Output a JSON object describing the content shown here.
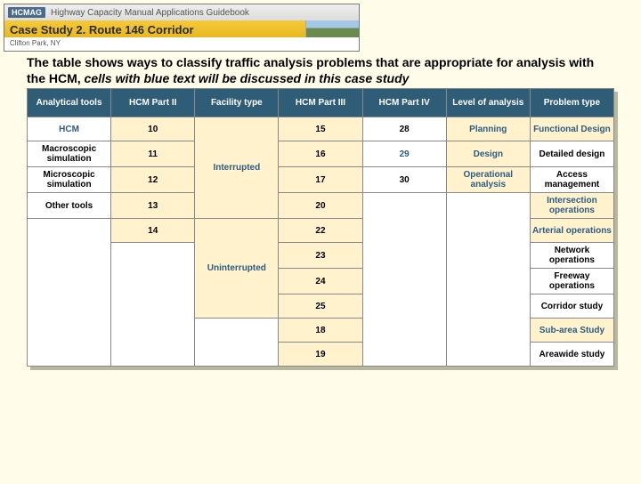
{
  "banner": {
    "tag": "HCMAG",
    "top": "Highway Capacity Manual Applications Guidebook",
    "title": "Case Study 2. Route 146 Corridor",
    "sub": "Clifton Park, NY"
  },
  "caption": {
    "bold": "The table shows ways to classify traffic analysis problems that are appropriate for analysis with the HCM,",
    "ital": " cells with blue text will be discussed in this case study"
  },
  "headers": [
    "Analytical tools",
    "HCM Part II",
    "Facility type",
    "HCM Part III",
    "HCM Part IV",
    "Level of analysis",
    "Problem type"
  ],
  "col0": [
    "HCM",
    "Macroscopic simulation",
    "Microscopic simulation",
    "Other tools"
  ],
  "col1": [
    "10",
    "11",
    "12",
    "13",
    "14"
  ],
  "col2": [
    "Interrupted",
    "Uninterrupted"
  ],
  "col3": [
    "15",
    "16",
    "17",
    "20",
    "22",
    "23",
    "24",
    "25",
    "18",
    "19"
  ],
  "col4": [
    "28",
    "29",
    "30"
  ],
  "col5": [
    "Planning",
    "Design",
    "Operational analysis"
  ],
  "col6": [
    "Functional Design",
    "Detailed design",
    "Access management",
    "Intersection operations",
    "Arterial operations",
    "Network operations",
    "Freeway operations",
    "Corridor study",
    "Sub-area Study",
    "Areawide study"
  ]
}
